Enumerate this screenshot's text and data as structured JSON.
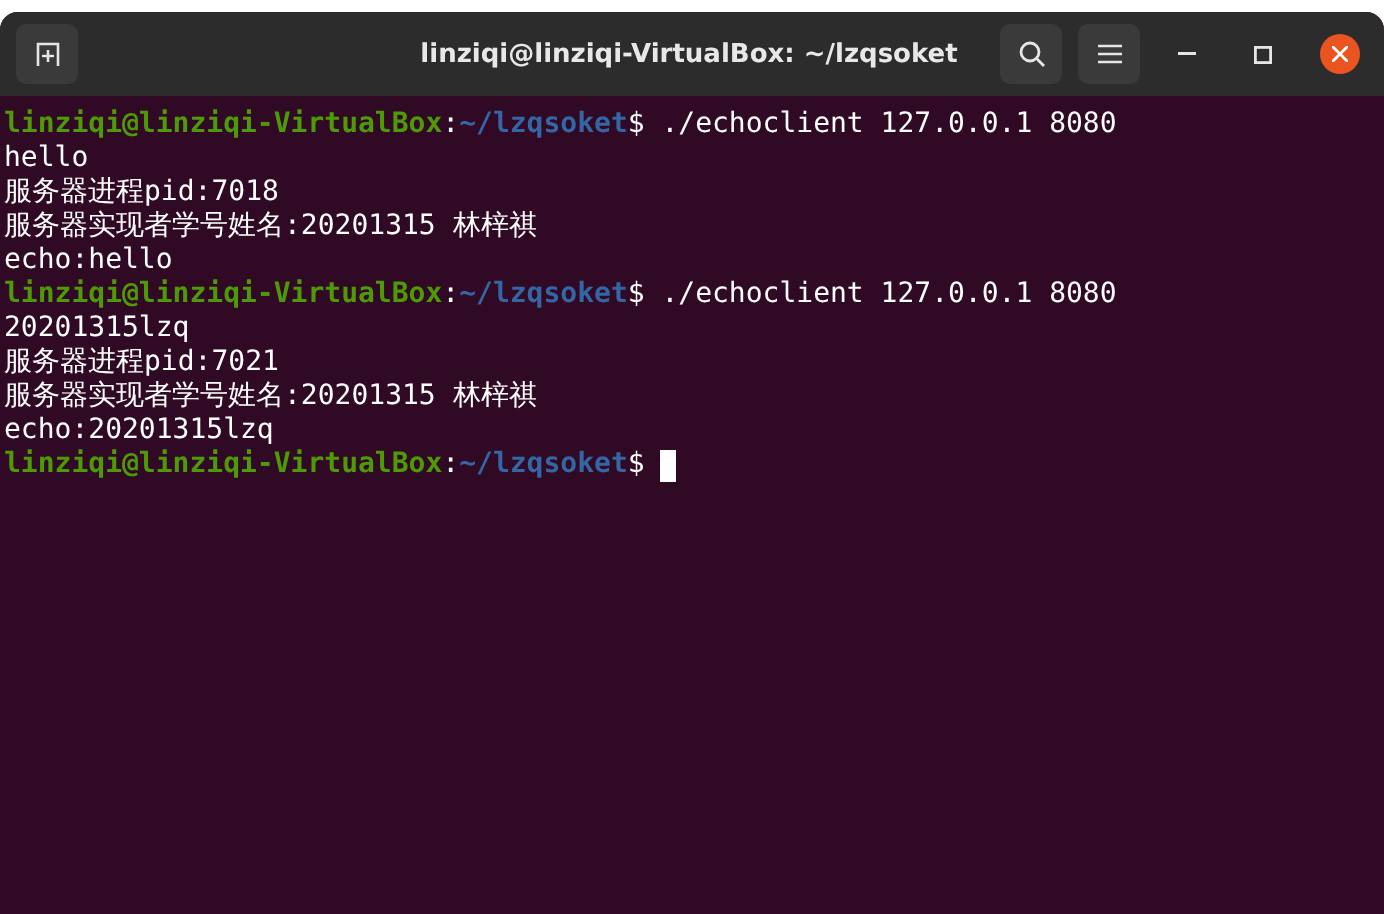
{
  "window": {
    "title": "linziqi@linziqi-VirtualBox: ~/lzqsoket"
  },
  "lines": [
    {
      "kind": "prompt",
      "user": "linziqi@linziqi-VirtualBox",
      "separator": ":",
      "path": "~/lzqsoket",
      "symbol": "$",
      "command": "./echoclient 127.0.0.1 8080",
      "cursor": false
    },
    {
      "kind": "output",
      "text": "hello"
    },
    {
      "kind": "output",
      "text": "服务器进程pid:7018"
    },
    {
      "kind": "output",
      "text": "服务器实现者学号姓名:20201315 林梓祺"
    },
    {
      "kind": "output",
      "text": "echo:hello"
    },
    {
      "kind": "prompt",
      "user": "linziqi@linziqi-VirtualBox",
      "separator": ":",
      "path": "~/lzqsoket",
      "symbol": "$",
      "command": "./echoclient 127.0.0.1 8080",
      "cursor": false
    },
    {
      "kind": "output",
      "text": "20201315lzq"
    },
    {
      "kind": "output",
      "text": "服务器进程pid:7021"
    },
    {
      "kind": "output",
      "text": "服务器实现者学号姓名:20201315 林梓祺"
    },
    {
      "kind": "output",
      "text": "echo:20201315lzq"
    },
    {
      "kind": "prompt",
      "user": "linziqi@linziqi-VirtualBox",
      "separator": ":",
      "path": "~/lzqsoket",
      "symbol": "$",
      "cursor": true
    }
  ]
}
